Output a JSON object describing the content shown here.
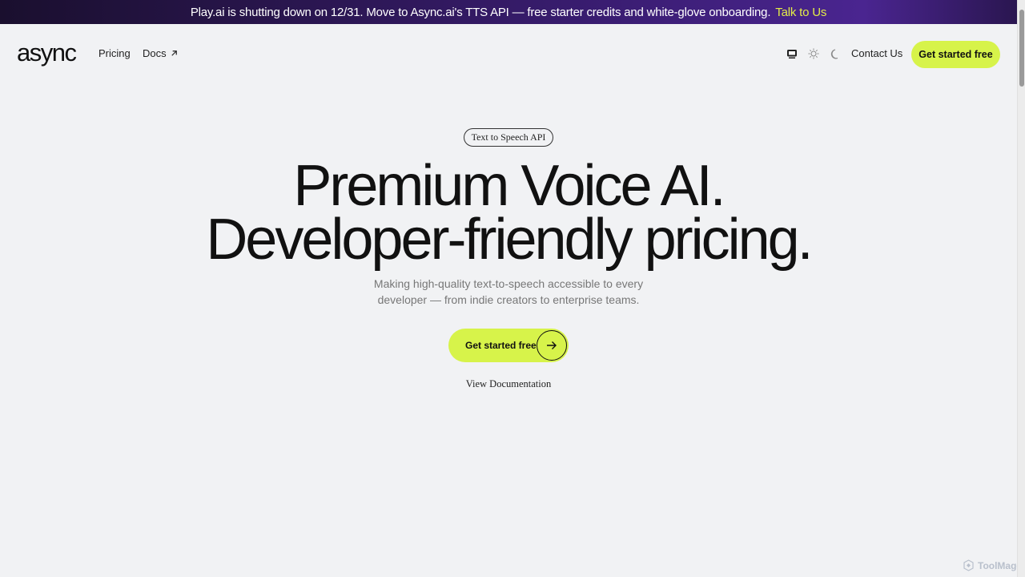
{
  "banner": {
    "message": "Play.ai is shutting down on 12/31. Move to Async.ai's TTS API — free starter credits and white-glove onboarding.",
    "cta": "Talk to Us"
  },
  "nav": {
    "logo": "async",
    "links": {
      "pricing": "Pricing",
      "docs": "Docs",
      "contact": "Contact Us"
    },
    "theme_icons": [
      "monitor-icon",
      "sun-icon",
      "moon-icon"
    ],
    "cta": "Get started free"
  },
  "hero": {
    "pill": "Text to Speech API",
    "headline_line1": "Premium Voice AI.",
    "headline_line2": "Developer-friendly pricing.",
    "subtitle_line1": "Making high-quality text-to-speech accessible to every",
    "subtitle_line2": "developer — from indie creators to enterprise teams.",
    "cta": "Get started free",
    "docs_link": "View Documentation"
  },
  "watermark": {
    "text": "ToolMage"
  },
  "colors": {
    "accent": "#d7f34a",
    "banner_cta": "#e2ec48",
    "background": "#f1f2f4"
  }
}
